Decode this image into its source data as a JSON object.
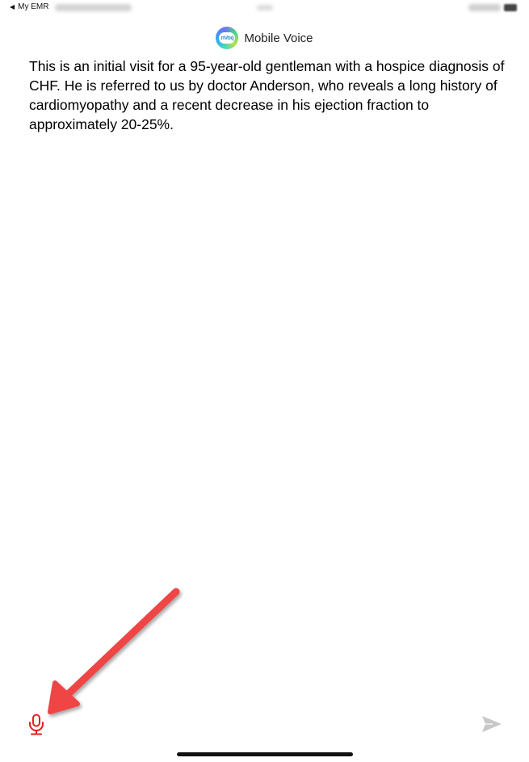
{
  "status_bar": {
    "back_label": "My EMR",
    "back_chevron": "◀"
  },
  "header": {
    "logo_text": "nVoq",
    "title": "Mobile Voice"
  },
  "transcript": {
    "text": "This is an initial visit for a 95-year-old gentleman with a hospice diagnosis of CHF. He is referred to us by doctor Anderson, who reveals a long history of cardiomyopathy and a recent decrease in his ejection fraction to approximately 20-25%."
  },
  "controls": {
    "mic_icon": "microphone-icon",
    "send_icon": "send-icon"
  },
  "colors": {
    "mic_red": "#e0201d",
    "send_gray": "#c8c8c8",
    "arrow_red": "#ef4444",
    "home_indicator": "#111111"
  }
}
